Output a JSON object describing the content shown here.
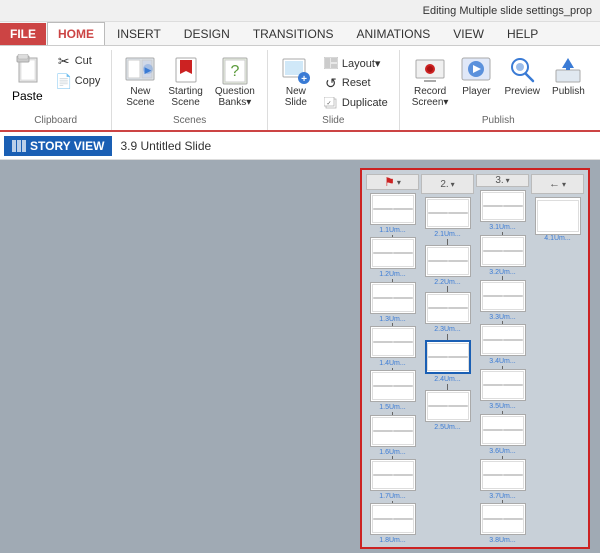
{
  "titleBar": {
    "text": "Editing Multiple slide settings_prop"
  },
  "tabs": [
    {
      "id": "file",
      "label": "FILE",
      "type": "file"
    },
    {
      "id": "home",
      "label": "HOME",
      "active": true
    },
    {
      "id": "insert",
      "label": "INSERT"
    },
    {
      "id": "design",
      "label": "DESIGN"
    },
    {
      "id": "transitions",
      "label": "TRANSITIONS"
    },
    {
      "id": "animations",
      "label": "ANIMATIONS"
    },
    {
      "id": "view",
      "label": "VIEW"
    },
    {
      "id": "help",
      "label": "HELP"
    }
  ],
  "ribbon": {
    "groups": [
      {
        "id": "clipboard",
        "label": "Clipboard",
        "buttons": [
          {
            "id": "paste",
            "label": "Paste",
            "icon": "📋",
            "size": "large"
          },
          {
            "id": "cut",
            "label": "Cut",
            "icon": "✂",
            "size": "small"
          },
          {
            "id": "copy",
            "label": "Copy",
            "icon": "📄",
            "size": "small"
          }
        ]
      },
      {
        "id": "scenes",
        "label": "Scenes",
        "buttons": [
          {
            "id": "new-scene",
            "label": "New Scene",
            "icon": "🎬"
          },
          {
            "id": "starting-scene",
            "label": "Starting Scene",
            "icon": "🚩"
          },
          {
            "id": "question-banks",
            "label": "Question Banks▾",
            "icon": "🏦"
          }
        ]
      },
      {
        "id": "slide",
        "label": "Slide",
        "buttons": [
          {
            "id": "new-slide",
            "label": "New Slide",
            "icon": "➕"
          },
          {
            "id": "layout",
            "label": "Layout▾",
            "icon": ""
          },
          {
            "id": "reset",
            "label": "Reset",
            "icon": ""
          },
          {
            "id": "duplicate",
            "label": "Duplicate",
            "icon": ""
          }
        ]
      },
      {
        "id": "publish",
        "label": "Publish",
        "buttons": [
          {
            "id": "record-screen",
            "label": "Record Screen▾",
            "icon": "🔴"
          },
          {
            "id": "player",
            "label": "Player",
            "icon": "▶"
          },
          {
            "id": "preview",
            "label": "Preview",
            "icon": "🔍"
          },
          {
            "id": "publish",
            "label": "Publish",
            "icon": "📤"
          }
        ]
      }
    ]
  },
  "storyView": {
    "buttonLabel": "STORY VIEW",
    "slideLabel": "3.9 Untitled Slide"
  },
  "slidePanel": {
    "columns": [
      {
        "header": "flag",
        "headerType": "flag",
        "slides": [
          {
            "label": "1.1Um...",
            "lines": 2
          },
          {
            "label": "1.2Um...",
            "lines": 2
          },
          {
            "label": "1.3Um...",
            "lines": 2
          },
          {
            "label": "1.4Um...",
            "lines": 2
          },
          {
            "label": "1.5Um...",
            "lines": 2
          },
          {
            "label": "1.6Um...",
            "lines": 2
          },
          {
            "label": "1.7Um...",
            "lines": 2
          },
          {
            "label": "1.8Um...",
            "lines": 2
          }
        ]
      },
      {
        "header": "2",
        "headerType": "num",
        "slides": [
          {
            "label": "2.1Um...",
            "lines": 2
          },
          {
            "label": "2.2Um...",
            "lines": 2
          },
          {
            "label": "2.3Um...",
            "lines": 2
          },
          {
            "label": "2.4Um...",
            "lines": 2,
            "selected": true
          },
          {
            "label": "2.5Um...",
            "lines": 2
          }
        ]
      },
      {
        "header": "3",
        "headerType": "num",
        "slides": [
          {
            "label": "3.1Um...",
            "lines": 2
          },
          {
            "label": "3.2Um...",
            "lines": 2
          },
          {
            "label": "3.3Um...",
            "lines": 2
          },
          {
            "label": "3.4Um...",
            "lines": 2
          },
          {
            "label": "3.5Um...",
            "lines": 2
          },
          {
            "label": "3.6Um...",
            "lines": 2
          },
          {
            "label": "3.7Um...",
            "lines": 2
          },
          {
            "label": "3.8Um...",
            "lines": 2
          }
        ]
      },
      {
        "header": "arrow",
        "headerType": "arrow",
        "slides": [
          {
            "label": "4.1Um...",
            "lines": 2,
            "single": true
          }
        ]
      }
    ]
  }
}
